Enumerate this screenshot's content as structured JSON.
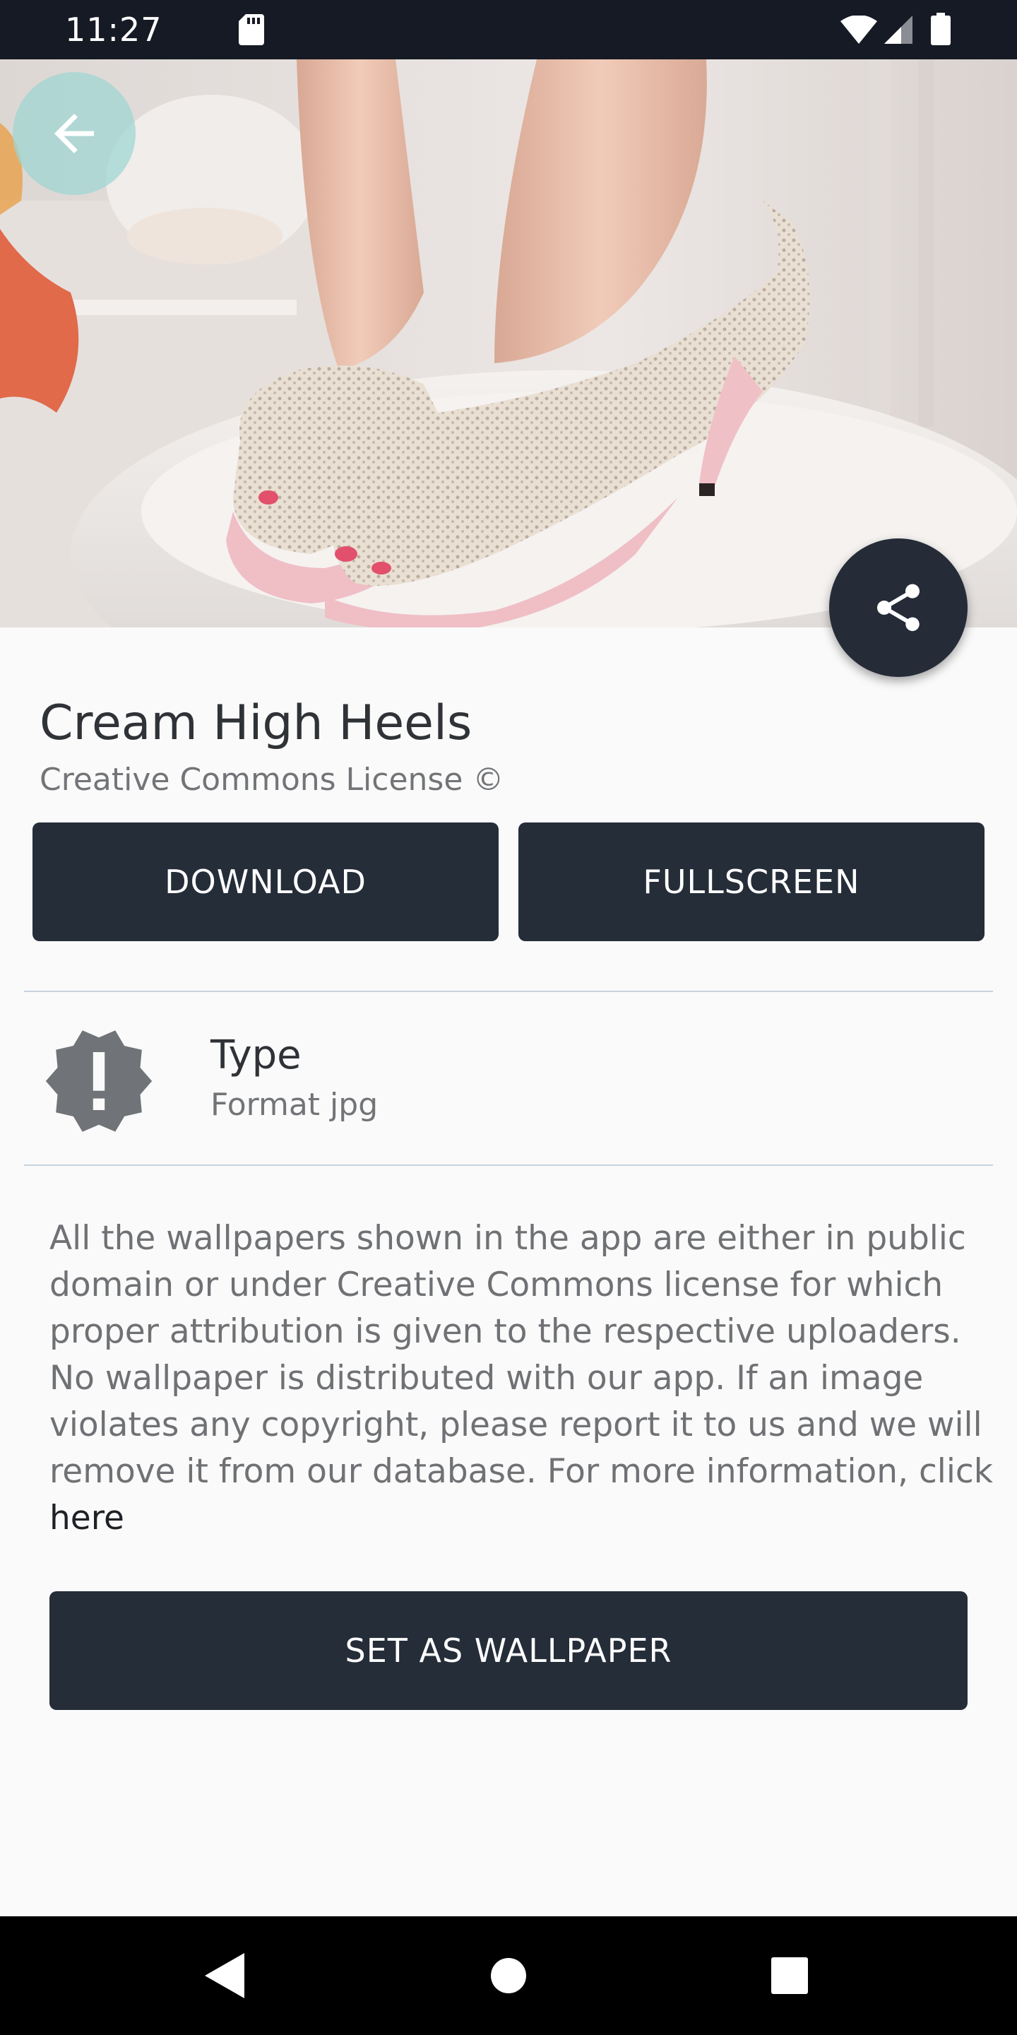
{
  "status_bar": {
    "time": "11:27",
    "icons": [
      "sd-card-icon",
      "wifi-icon",
      "signal-icon",
      "battery-icon"
    ]
  },
  "hero": {
    "image": "cream-high-heels-photo",
    "back_icon": "arrow-left-icon",
    "share_icon": "share-icon"
  },
  "wallpaper": {
    "title": "Cream High Heels",
    "license": "Creative Commons License ©"
  },
  "actions": {
    "download_label": "DOWNLOAD",
    "fullscreen_label": "FULLSCREEN",
    "set_wallpaper_label": "SET AS WALLPAPER"
  },
  "details": {
    "type_icon": "alert-badge-icon",
    "type_label": "Type",
    "type_value": "Format jpg"
  },
  "disclaimer": {
    "lines": [
      "All the wallpapers shown in the app are either in public",
      "domain or under Creative Commons license for which",
      "proper attribution is given to the respective uploaders.",
      "No wallpaper is distributed with our app. If an image",
      "violates any copyright, please report it to us and we will",
      "remove it from our database. For more information, click"
    ],
    "link_text": "here"
  },
  "colors": {
    "primary_dark": "#252d39",
    "status_bar": "#151a24",
    "background": "#fafafa",
    "back_button": "#a0d6d2"
  }
}
